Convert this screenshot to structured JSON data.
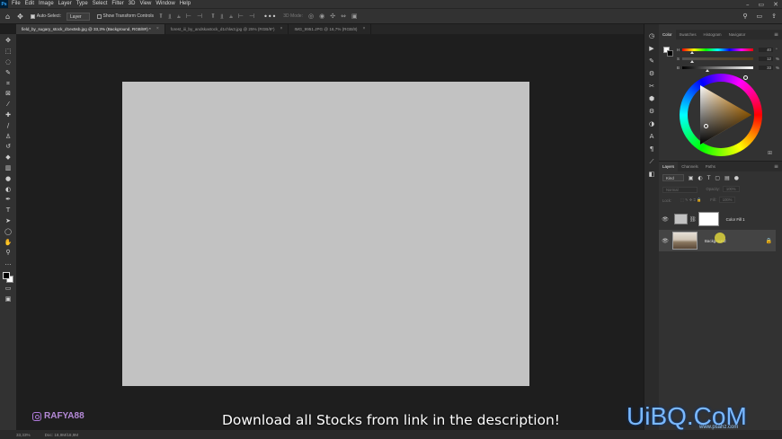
{
  "app": {
    "logo": "Ps"
  },
  "menu": [
    "File",
    "Edit",
    "Image",
    "Layer",
    "Type",
    "Select",
    "Filter",
    "3D",
    "View",
    "Window",
    "Help"
  ],
  "window_controls": {
    "minimize": "–",
    "restore": "▭",
    "close": "✕"
  },
  "options": {
    "auto_select_label": "Auto-Select:",
    "auto_select_target": "Layer",
    "transform_label": "Show Transform Controls",
    "mode_3d_label": "3D Mode:"
  },
  "tabs": [
    {
      "label": "field_by_sugary_stock_d1ex5sb.jpg @ 33,3% (Background, RGB/8#) *",
      "active": true
    },
    {
      "label": "forest_iii_by_andskastock_d1chlw3.jpg @ 25% (RGB/8*)",
      "active": false
    },
    {
      "label": "IMG_9951.JPG @ 16,7% (RGB/8)",
      "active": false
    }
  ],
  "status": {
    "zoom": "33,33%",
    "doc": "Doc: 18,9M/18,9M"
  },
  "color_panel": {
    "tabs": [
      "Color",
      "Swatches",
      "Histogram",
      "Navigator"
    ],
    "sliders": [
      {
        "label": "H",
        "value": "40",
        "unit": "°",
        "pos": 0.12,
        "hue": true
      },
      {
        "label": "S",
        "value": "12",
        "unit": "%",
        "pos": 0.12,
        "hue": false
      },
      {
        "label": "B",
        "value": "33",
        "unit": "%",
        "pos": 0.33,
        "hue": false
      }
    ]
  },
  "layers_panel": {
    "tabs": [
      "Layers",
      "Channels",
      "Paths"
    ],
    "filter_kind": "Kind",
    "blend_mode": "Normal",
    "opacity_label": "Opacity:",
    "opacity_value": "100%",
    "lock_label": "Lock:",
    "fill_label": "Fill:",
    "fill_value": "100%",
    "layers": [
      {
        "name": "Color Fill 1",
        "type": "fill",
        "selected": false
      },
      {
        "name": "Background",
        "type": "photo",
        "selected": true,
        "locked": true
      }
    ]
  },
  "overlay": {
    "ig_handle": "RAFYA88",
    "caption": "Download all Stocks from link in the description!",
    "site_logo": "UiBQ.CoM",
    "site_sub": "www.psahz.com"
  },
  "colors": {
    "canvas": "#c2c2c2",
    "panel": "#323232",
    "workspace": "#1e1e1e"
  }
}
